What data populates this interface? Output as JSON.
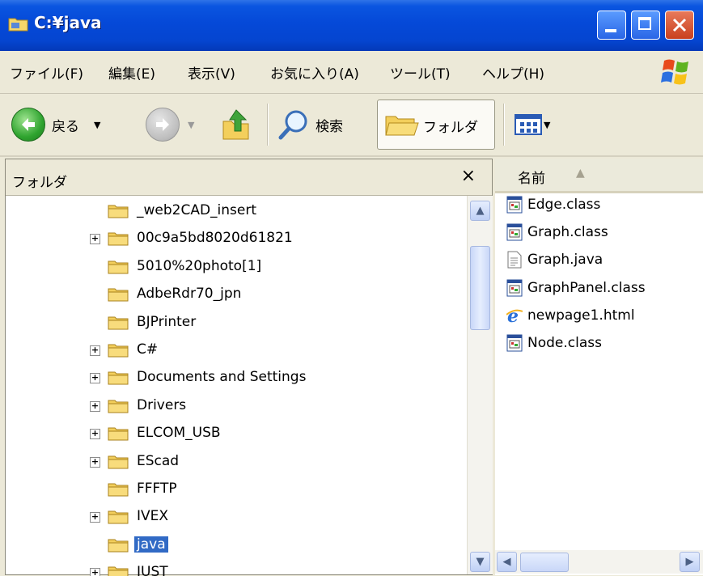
{
  "window": {
    "title": "C:¥java"
  },
  "menu": {
    "items": [
      "ファイル(F)",
      "編集(E)",
      "表示(V)",
      "お気に入り(A)",
      "ツール(T)",
      "ヘルプ(H)"
    ]
  },
  "toolbar": {
    "back_label": "戻る",
    "search_label": "検索",
    "folders_label": "フォルダ"
  },
  "folder_pane": {
    "title": "フォルダ",
    "close_glyph": "×",
    "items": [
      {
        "label": "_web2CAD_insert",
        "expandable": false,
        "selected": false
      },
      {
        "label": "00c9a5bd8020d61821",
        "expandable": true,
        "selected": false
      },
      {
        "label": "5010%20photo[1]",
        "expandable": false,
        "selected": false
      },
      {
        "label": "AdbeRdr70_jpn",
        "expandable": false,
        "selected": false
      },
      {
        "label": "BJPrinter",
        "expandable": false,
        "selected": false
      },
      {
        "label": "C#",
        "expandable": true,
        "selected": false
      },
      {
        "label": "Documents and Settings",
        "expandable": true,
        "selected": false
      },
      {
        "label": "Drivers",
        "expandable": true,
        "selected": false
      },
      {
        "label": "ELCOM_USB",
        "expandable": true,
        "selected": false
      },
      {
        "label": "EScad",
        "expandable": true,
        "selected": false
      },
      {
        "label": "FFFTP",
        "expandable": false,
        "selected": false
      },
      {
        "label": "IVEX",
        "expandable": true,
        "selected": false
      },
      {
        "label": "java",
        "expandable": false,
        "selected": true
      },
      {
        "label": "JUST",
        "expandable": true,
        "selected": false
      }
    ]
  },
  "file_pane": {
    "column_header": "名前",
    "files": [
      {
        "name": "Edge.class",
        "icon": "class-file-icon"
      },
      {
        "name": "Graph.class",
        "icon": "class-file-icon"
      },
      {
        "name": "Graph.java",
        "icon": "text-file-icon"
      },
      {
        "name": "GraphPanel.class",
        "icon": "class-file-icon"
      },
      {
        "name": "newpage1.html",
        "icon": "ie-html-icon"
      },
      {
        "name": "Node.class",
        "icon": "class-file-icon"
      }
    ]
  },
  "colors": {
    "titlebar": "#0549d8",
    "selection": "#316ac5",
    "chrome": "#ece9d8"
  }
}
